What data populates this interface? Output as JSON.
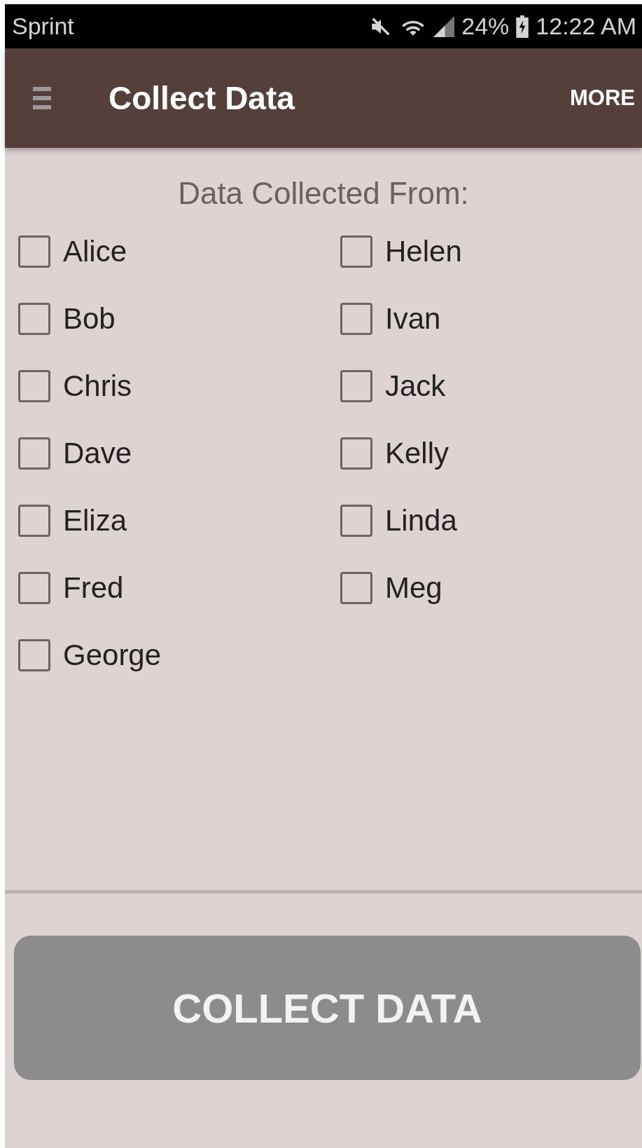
{
  "status_bar": {
    "carrier": "Sprint",
    "battery": "24%",
    "time": "12:22 AM"
  },
  "app_bar": {
    "title": "Collect Data",
    "action": "MORE"
  },
  "heading": "Data Collected From:",
  "people": [
    {
      "name": "Alice",
      "checked": false
    },
    {
      "name": "Bob",
      "checked": false
    },
    {
      "name": "Chris",
      "checked": false
    },
    {
      "name": "Dave",
      "checked": false
    },
    {
      "name": "Eliza",
      "checked": false
    },
    {
      "name": "Fred",
      "checked": false
    },
    {
      "name": "George",
      "checked": false
    },
    {
      "name": "Helen",
      "checked": false
    },
    {
      "name": "Ivan",
      "checked": false
    },
    {
      "name": "Jack",
      "checked": false
    },
    {
      "name": "Kelly",
      "checked": false
    },
    {
      "name": "Linda",
      "checked": false
    },
    {
      "name": "Meg",
      "checked": false
    }
  ],
  "button": {
    "label": "COLLECT DATA",
    "disabled": true
  }
}
